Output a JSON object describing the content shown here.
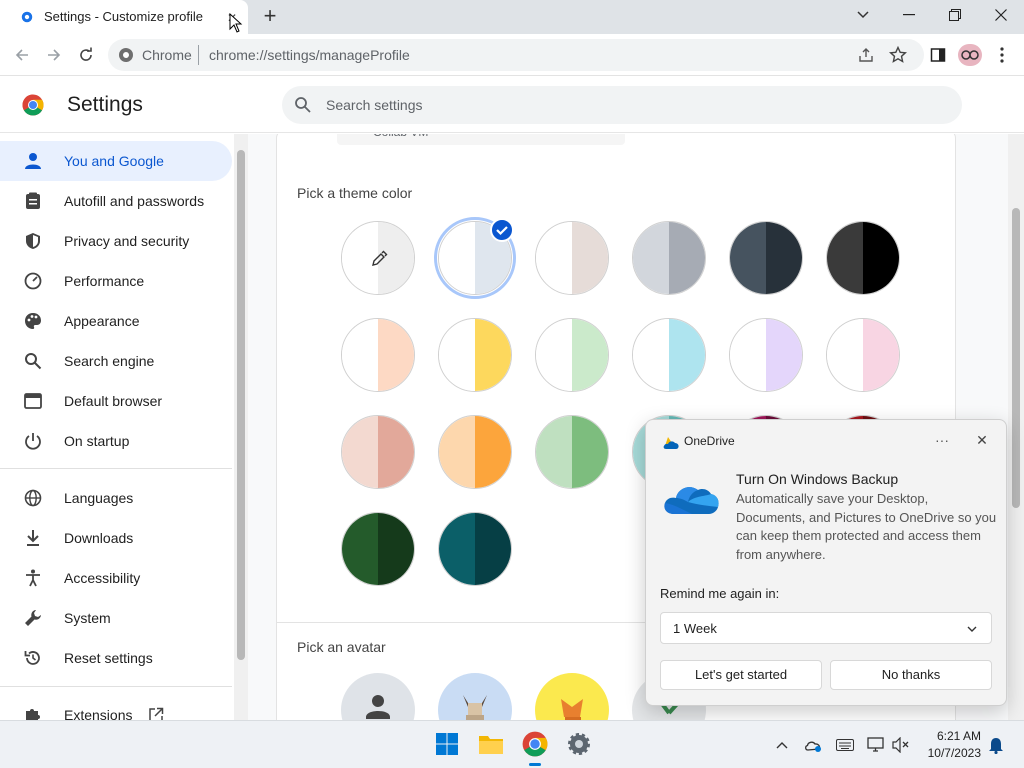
{
  "tab": {
    "title": "Settings - Customize profile",
    "close_glyph": "✕",
    "new_tab_glyph": "+"
  },
  "window": {
    "minimize_icon": "minimize-icon",
    "restore_icon": "restore-icon",
    "close_icon": "close-icon"
  },
  "toolbar": {
    "scheme": "Chrome",
    "url": "chrome://settings/manageProfile"
  },
  "header": {
    "title": "Settings",
    "search_placeholder": "Search settings"
  },
  "sidebar": {
    "items": [
      {
        "label": "You and Google",
        "icon": "person-icon",
        "active": true
      },
      {
        "label": "Autofill and passwords",
        "icon": "clipboard-icon"
      },
      {
        "label": "Privacy and security",
        "icon": "shield-icon"
      },
      {
        "label": "Performance",
        "icon": "gauge-icon"
      },
      {
        "label": "Appearance",
        "icon": "palette-icon"
      },
      {
        "label": "Search engine",
        "icon": "search-icon"
      },
      {
        "label": "Default browser",
        "icon": "browser-icon"
      },
      {
        "label": "On startup",
        "icon": "power-icon"
      },
      {
        "label": "Languages",
        "icon": "globe-icon"
      },
      {
        "label": "Downloads",
        "icon": "download-icon"
      },
      {
        "label": "Accessibility",
        "icon": "accessibility-icon"
      },
      {
        "label": "System",
        "icon": "wrench-icon"
      },
      {
        "label": "Reset settings",
        "icon": "reset-icon"
      },
      {
        "label": "Extensions",
        "icon": "puzzle-icon"
      }
    ]
  },
  "main": {
    "prev_field_text": "Collab VM",
    "theme_title": "Pick a theme color",
    "avatar_title": "Pick an avatar",
    "themes": [
      {
        "l": "#ffffff",
        "r": "#eeeeee",
        "custom": true
      },
      {
        "l": "#ffffff",
        "r": "#dfe6ee",
        "selected": true
      },
      {
        "l": "#ffffff",
        "r": "#e6dcd8"
      },
      {
        "l": "#d2d6dc",
        "r": "#a6abb4"
      },
      {
        "l": "#46535f",
        "r": "#27313a"
      },
      {
        "l": "#3a3a3a",
        "r": "#000000"
      },
      {
        "l": "#ffffff",
        "r": "#fdd9c4"
      },
      {
        "l": "#ffffff",
        "r": "#fdd85d"
      },
      {
        "l": "#ffffff",
        "r": "#cbeacb"
      },
      {
        "l": "#ffffff",
        "r": "#aee4ef"
      },
      {
        "l": "#ffffff",
        "r": "#e4d6fb"
      },
      {
        "l": "#ffffff",
        "r": "#f8d5e3"
      },
      {
        "l": "#f3d9d0",
        "r": "#e2a89a"
      },
      {
        "l": "#fdd7ad",
        "r": "#fca53c"
      },
      {
        "l": "#bfe0c0",
        "r": "#7dbd7e"
      },
      {
        "l": "#a6dad8",
        "r": "#65b8b5"
      },
      {
        "l": "#9f1559",
        "r": "#6b0d38"
      },
      {
        "l": "#a6181f",
        "r": "#6e1013"
      },
      {
        "l": "#245b2b",
        "r": "#153a1b"
      },
      {
        "l": "#0b5f68",
        "r": "#063f45"
      }
    ]
  },
  "onedrive": {
    "title": "OneDrive",
    "more": "···",
    "close": "✕",
    "heading": "Turn On Windows Backup",
    "body": "Automatically save your Desktop, Documents, and Pictures to OneDrive so you can keep them protected and access them from anywhere.",
    "remind_label": "Remind me again in:",
    "remind_value": "1 Week",
    "primary": "Let's get started",
    "secondary": "No thanks"
  },
  "taskbar": {
    "time": "6:21 AM",
    "date": "10/7/2023"
  },
  "colors": {
    "accent": "#0b57d0",
    "active_bg": "#e8f0fe"
  }
}
